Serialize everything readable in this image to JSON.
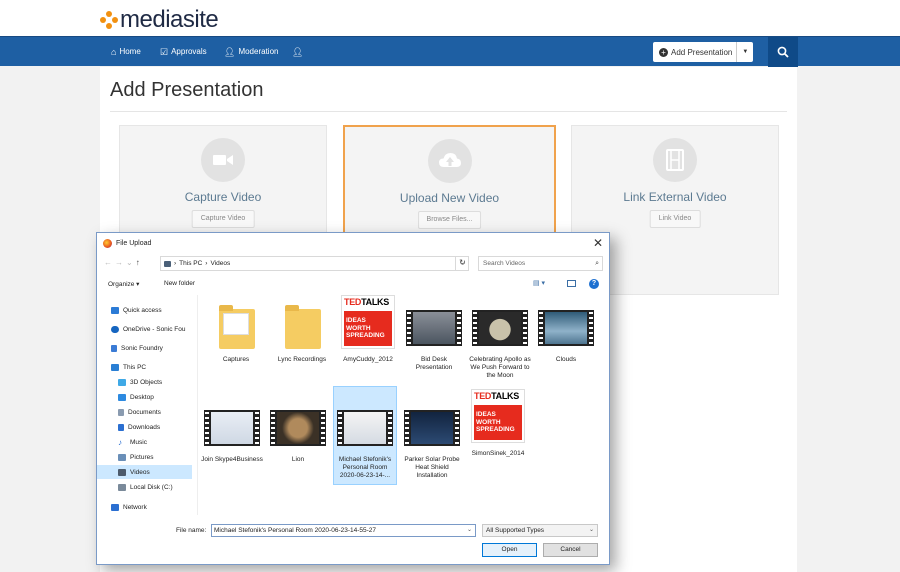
{
  "brand": {
    "name": "mediasite",
    "accent": "#f29111",
    "nav_bg": "#1e5fa3"
  },
  "nav": {
    "items": [
      {
        "label": "Home",
        "icon": "home-icon"
      },
      {
        "label": "Approvals",
        "icon": "checkbox-icon"
      },
      {
        "label": "Moderation",
        "icon": "user-icon"
      },
      {
        "label": "",
        "icon": "user-icon"
      }
    ],
    "add_presentation": "Add Presentation"
  },
  "page": {
    "title": "Add Presentation",
    "cards": [
      {
        "title": "Capture Video",
        "button": "Capture Video",
        "icon": "video-camera-icon"
      },
      {
        "title": "Upload New Video",
        "button": "Browse Files...",
        "icon": "cloud-upload-icon"
      },
      {
        "title": "Link External Video",
        "button": "Link Video",
        "icon": "film-icon"
      }
    ]
  },
  "dialog": {
    "title": "File Upload",
    "path": [
      "This PC",
      "Videos"
    ],
    "search_placeholder": "Search Videos",
    "toolbar": {
      "organize": "Organize ▾",
      "new_folder": "New folder"
    },
    "sidebar": [
      {
        "label": "Quick access",
        "icon": "star-icon",
        "color": "#2b7bd6"
      },
      {
        "label": "OneDrive - Sonic Fou",
        "icon": "cloud-icon",
        "color": "#1565c0"
      },
      {
        "label": "Sonic Foundry",
        "icon": "user-folder-icon",
        "color": "#3a7bd5"
      },
      {
        "label": "This PC",
        "icon": "pc-icon",
        "color": "#2a7fd4"
      },
      {
        "label": "3D Objects",
        "icon": "cube-icon",
        "color": "#3fa9e6"
      },
      {
        "label": "Desktop",
        "icon": "desktop-icon",
        "color": "#2d8ae0"
      },
      {
        "label": "Documents",
        "icon": "document-icon",
        "color": "#8a9bb0"
      },
      {
        "label": "Downloads",
        "icon": "download-icon",
        "color": "#2b6fd1"
      },
      {
        "label": "Music",
        "icon": "music-icon",
        "color": "#2b6fd1"
      },
      {
        "label": "Pictures",
        "icon": "picture-icon",
        "color": "#6a8fb8"
      },
      {
        "label": "Videos",
        "icon": "video-icon",
        "color": "#4c5a6b"
      },
      {
        "label": "Local Disk (C:)",
        "icon": "disk-icon",
        "color": "#7a8a9a"
      },
      {
        "label": "Network",
        "icon": "network-icon",
        "color": "#2b6fd1"
      }
    ],
    "files": [
      {
        "name": "Captures",
        "kind": "folder"
      },
      {
        "name": "Lync Recordings",
        "kind": "folder"
      },
      {
        "name": "AmyCuddy_2012",
        "kind": "ted"
      },
      {
        "name": "Bid Desk Presentation",
        "kind": "video"
      },
      {
        "name": "Celebrating Apollo as We Push Forward to the Moon",
        "kind": "video"
      },
      {
        "name": "Clouds",
        "kind": "video"
      },
      {
        "name": "Join Skype4Business",
        "kind": "video"
      },
      {
        "name": "Lion",
        "kind": "video"
      },
      {
        "name": "Michael Stefonik's Personal Room 2020-06-23-14-...",
        "kind": "video"
      },
      {
        "name": "Parker Solar Probe Heat Shield Installation",
        "kind": "video"
      },
      {
        "name": "SimonSinek_2014",
        "kind": "ted"
      }
    ],
    "ted": {
      "brand_red": "TED",
      "brand_black": "TALKS",
      "tagline": "IDEAS WORTH SPREADING"
    },
    "file_name_label": "File name:",
    "file_name_value": "Michael Stefonik's Personal Room 2020-06-23-14-55-27",
    "file_type": "All Supported Types",
    "open": "Open",
    "cancel": "Cancel"
  }
}
